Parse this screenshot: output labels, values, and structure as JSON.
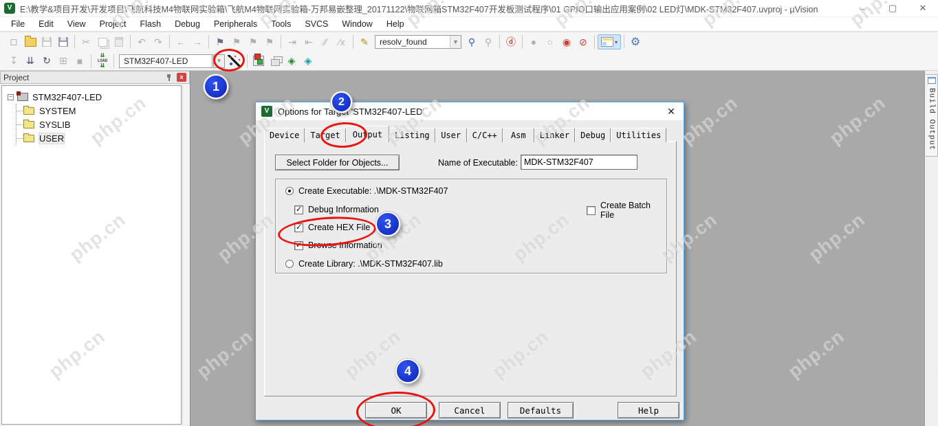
{
  "window": {
    "title": "E:\\教学&项目开发\\开发项目\\飞航科技M4物联网实验箱\\飞航M4物联网实验箱-万邦易嵌整理_20171122\\物联网箱STM32F407开发板测试程序\\01 GPIO口输出应用案例\\02 LED灯\\MDK-STM32F407.uvproj - µVision",
    "minimize": "–",
    "maximize": "▢",
    "close": "✕",
    "app_icon_text": "V"
  },
  "menu": {
    "items": [
      "File",
      "Edit",
      "View",
      "Project",
      "Flash",
      "Debug",
      "Peripherals",
      "Tools",
      "SVCS",
      "Window",
      "Help"
    ]
  },
  "toolbar1": {
    "icons_left": [
      {
        "name": "new-file-icon",
        "glyph": "□"
      },
      {
        "name": "open-folder-icon",
        "kind": "folder"
      },
      {
        "name": "save-icon",
        "kind": "floppy",
        "disabled": true
      },
      {
        "name": "save-all-icon",
        "kind": "floppy blue"
      },
      {
        "sep": true
      },
      {
        "name": "cut-icon",
        "glyph": "✂",
        "disabled": true
      },
      {
        "name": "copy-icon",
        "kind": "copy",
        "disabled": true
      },
      {
        "name": "paste-icon",
        "kind": "paste",
        "disabled": true
      },
      {
        "sep": true
      },
      {
        "name": "undo-icon",
        "glyph": "↶",
        "disabled": true
      },
      {
        "name": "redo-icon",
        "glyph": "↷",
        "disabled": true
      },
      {
        "sep": true
      },
      {
        "name": "navigate-back-icon",
        "glyph": "←",
        "disabled": true
      },
      {
        "name": "navigate-forward-icon",
        "glyph": "→",
        "disabled": true
      },
      {
        "sep": true
      },
      {
        "name": "toggle-bookmark-icon",
        "glyph": "⚑"
      },
      {
        "name": "previous-bookmark-icon",
        "glyph": "⚑",
        "disabled": true
      },
      {
        "name": "next-bookmark-icon",
        "glyph": "⚑",
        "disabled": true
      },
      {
        "name": "clear-bookmarks-icon",
        "glyph": "⚑",
        "disabled": true
      },
      {
        "sep": true
      },
      {
        "name": "indent-icon",
        "glyph": "⇥",
        "disabled": true
      },
      {
        "name": "unindent-icon",
        "glyph": "⇤",
        "disabled": true
      },
      {
        "name": "comment-icon",
        "glyph": "∕∕",
        "disabled": true
      },
      {
        "name": "uncomment-icon",
        "glyph": "∕x",
        "disabled": true
      },
      {
        "sep": true
      },
      {
        "name": "configure-find-icon",
        "glyph": "✎",
        "color": "#b88a10"
      }
    ],
    "search_value": "resolv_found",
    "icons_right": [
      {
        "name": "find-in-files-icon",
        "glyph": "⚲",
        "color": "#3a62b0"
      },
      {
        "name": "grep-icon",
        "glyph": "⚲",
        "disabled": true
      },
      {
        "sep": true
      },
      {
        "name": "lookup-word-icon",
        "glyph": "ⓓ",
        "color": "#c01818"
      },
      {
        "sep": true
      },
      {
        "name": "insert-breakpoint-icon",
        "glyph": "●",
        "disabled": true
      },
      {
        "name": "enable-breakpoint-icon",
        "glyph": "○",
        "disabled": true
      },
      {
        "name": "disable-all-breakpoints-icon",
        "glyph": "◉",
        "color": "#d23b30"
      },
      {
        "name": "kill-all-breakpoints-icon",
        "glyph": "⊘",
        "color": "#d23b30"
      },
      {
        "sep": true
      }
    ],
    "window_layout_dropdown": "▾",
    "configure_wrench": {
      "name": "configure-tools-icon",
      "glyph": "⚙",
      "color": "#4a74b8"
    }
  },
  "toolbar2": {
    "icons_left": [
      {
        "name": "translate-icon",
        "glyph": "↧",
        "disabled": true
      },
      {
        "name": "build-icon",
        "glyph": "⇊",
        "color": "#4a4a6a"
      },
      {
        "name": "rebuild-icon",
        "glyph": "↻",
        "color": "#4a4a6a"
      },
      {
        "name": "batch-build-icon",
        "glyph": "⊞",
        "disabled": true
      },
      {
        "name": "stop-build-icon",
        "glyph": "■",
        "disabled": true
      },
      {
        "sep": true
      },
      {
        "name": "download-icon",
        "glyph": "LOAD",
        "kind": "load"
      },
      {
        "sep": true
      }
    ],
    "target_select": "STM32F407-LED",
    "target_dropdown": "▾",
    "icons_right": [
      {
        "sep": true
      },
      {
        "name": "manage-run-time-environment-icon",
        "kind": "cubes"
      },
      {
        "name": "manage-project-items-icon",
        "kind": "stack"
      },
      {
        "name": "select-software-packs-icon",
        "glyph": "◈",
        "color": "#1d8a28"
      },
      {
        "name": "pack-installer-icon",
        "glyph": "◈",
        "color": "#12a0a8"
      }
    ]
  },
  "project_panel": {
    "title": "Project",
    "close": "x",
    "root": "STM32F407-LED",
    "expander": "−",
    "children": [
      "SYSTEM",
      "SYSLIB",
      "USER"
    ],
    "selected": "USER"
  },
  "right_strip": {
    "build_output_label": "Build Output"
  },
  "dialog": {
    "title": "Options for Target 'STM32F407-LED'",
    "icon_text": "V",
    "close": "✕",
    "tabs": [
      "Device",
      "Target",
      "Output",
      "Listing",
      "User",
      "C/C++",
      "Asm",
      "Linker",
      "Debug",
      "Utilities"
    ],
    "active_tab": "Output",
    "select_folder_button": "Select Folder for Objects...",
    "exe_label": "Name of Executable:",
    "exe_value": "MDK-STM32F407",
    "create_executable_label": "Create Executable:  .\\MDK-STM32F407",
    "create_executable_checked": true,
    "debug_information_label": "Debug Information",
    "debug_information_checked": true,
    "create_hex_label": "Create HEX File",
    "create_hex_checked": true,
    "browse_information_label": "Browse Information",
    "browse_information_checked": true,
    "create_library_label": "Create Library:  .\\MDK-STM32F407.lib",
    "create_library_checked": false,
    "create_batch_label": "Create Batch File",
    "create_batch_checked": false,
    "buttons": {
      "ok": "OK",
      "cancel": "Cancel",
      "defaults": "Defaults",
      "help": "Help"
    }
  },
  "watermark": {
    "text": "php.cn"
  },
  "annotations": {
    "badges": [
      "1",
      "2",
      "3",
      "4"
    ]
  },
  "colors": {
    "annotation_red": "#e8140f",
    "badge_blue": "#1b34c8",
    "workspace_gray": "#a9a9a9",
    "dialog_border_blue": "#4aa3e8"
  }
}
